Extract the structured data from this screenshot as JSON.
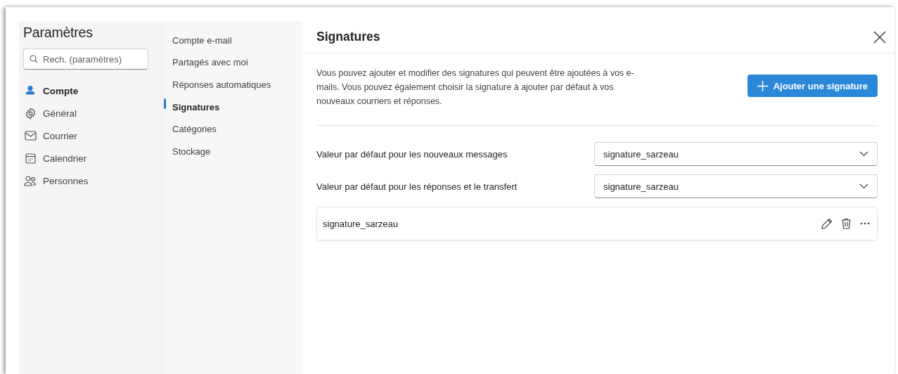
{
  "settings": {
    "title": "Paramètres",
    "search": {
      "placeholder": "Rech. (paramètres)"
    },
    "categories": [
      {
        "label": "Compte",
        "selected": true
      },
      {
        "label": "Général",
        "selected": false
      },
      {
        "label": "Courrier",
        "selected": false
      },
      {
        "label": "Calendrier",
        "selected": false
      },
      {
        "label": "Personnes",
        "selected": false
      }
    ]
  },
  "subnav": [
    {
      "label": "Compte e-mail",
      "selected": false
    },
    {
      "label": "Partagés avec moi",
      "selected": false
    },
    {
      "label": "Réponses automatiques",
      "selected": false
    },
    {
      "label": "Signatures",
      "selected": true
    },
    {
      "label": "Catégories",
      "selected": false
    },
    {
      "label": "Stockage",
      "selected": false
    }
  ],
  "panel": {
    "title": "Signatures",
    "description": "Vous pouvez ajouter et modifier des signatures qui peuvent être ajoutées à vos e-mails. Vous pouvez également choisir la signature à ajouter par défaut à vos nouveaux courriers et réponses.",
    "add_button": "Ajouter une signature",
    "defaults": [
      {
        "label": "Valeur par défaut pour les nouveaux messages",
        "value": "signature_sarzeau"
      },
      {
        "label": "Valeur par défaut pour les réponses et le transfert",
        "value": "signature_sarzeau"
      }
    ],
    "signatures": [
      {
        "name": "signature_sarzeau"
      }
    ]
  }
}
